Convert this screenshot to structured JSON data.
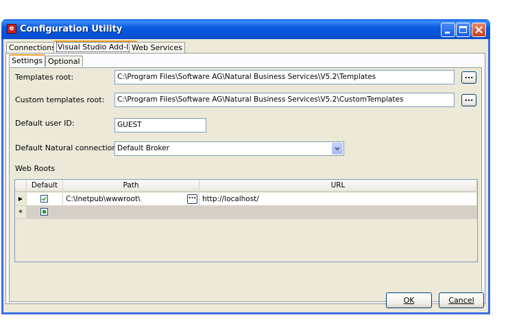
{
  "window": {
    "title": "Configuration Utility"
  },
  "tabs": [
    {
      "label": "Connections",
      "active": false
    },
    {
      "label": "Visual Studio Add-In",
      "active": true
    },
    {
      "label": "Web Services",
      "active": false
    }
  ],
  "subtabs": [
    {
      "label": "Settings",
      "active": true
    },
    {
      "label": "Optional",
      "active": false
    }
  ],
  "form": {
    "templates_root_label": "Templates root:",
    "templates_root_value": "C:\\Program Files\\Software AG\\Natural Business Services\\V5.2\\Templates",
    "custom_templates_root_label": "Custom templates root:",
    "custom_templates_root_value": "C:\\Program Files\\Software AG\\Natural Business Services\\V5.2\\CustomTemplates",
    "default_user_id_label": "Default user ID:",
    "default_user_id_value": "GUEST",
    "default_connection_label": "Default Natural connection:",
    "default_connection_value": "Default Broker",
    "browse_label": "...",
    "web_roots_label": "Web Roots"
  },
  "grid": {
    "headers": {
      "default": "Default",
      "path": "Path",
      "url": "URL"
    },
    "rows": [
      {
        "indicator": "▶",
        "checked": true,
        "path": "C:\\Inetpub\\wwwroot\\",
        "url": "http://localhost/"
      }
    ],
    "new_row_indicator": "*"
  },
  "buttons": {
    "ok": "OK",
    "cancel": "Cancel"
  },
  "colors": {
    "title_bar": "#0a5ae0",
    "dialog_bg": "#ece9d8",
    "tab_highlight": "#f1a02c"
  }
}
